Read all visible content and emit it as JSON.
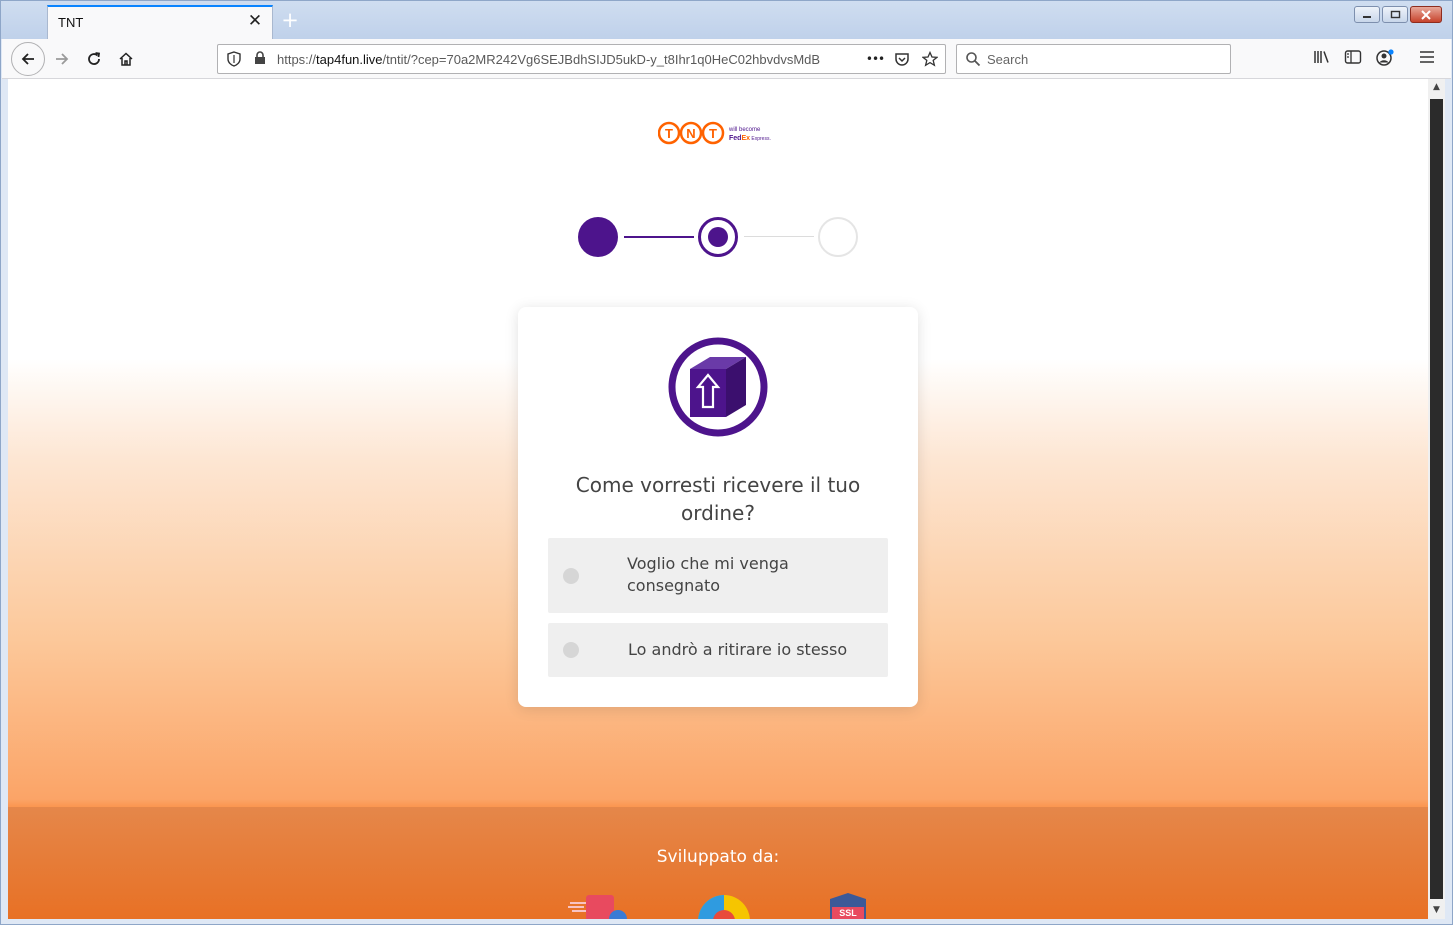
{
  "browser": {
    "tab_title": "TNT",
    "tab_close": "✕",
    "new_tab": "+",
    "url_prefix": "https://",
    "url_domain": "tap4fun.live",
    "url_rest": "/tntit/?cep=70a2MR242Vg6SEJBdhSIJD5ukD-y_t8Ihr1q0HeC02hbvdvsMdB",
    "page_actions": "•••",
    "search_placeholder": "Search"
  },
  "page": {
    "logo_text": "TNT",
    "logo_tagline_1": "will become",
    "logo_tagline_2": "FedEx",
    "logo_tagline_3": "Express.",
    "stepper": {
      "total_steps": 3,
      "current_step": 2
    },
    "question": "Come vorresti ricevere il tuo ordine?",
    "options": [
      {
        "label": "Voglio che mi venga consegnato"
      },
      {
        "label": "Lo andrò a ritirare io stesso"
      }
    ],
    "footer_title": "Sviluppato da:",
    "ssl_badge": "SSL"
  },
  "colors": {
    "brand_purple": "#4d148c",
    "brand_orange": "#ff6200",
    "footer_orange": "#e86f22"
  }
}
